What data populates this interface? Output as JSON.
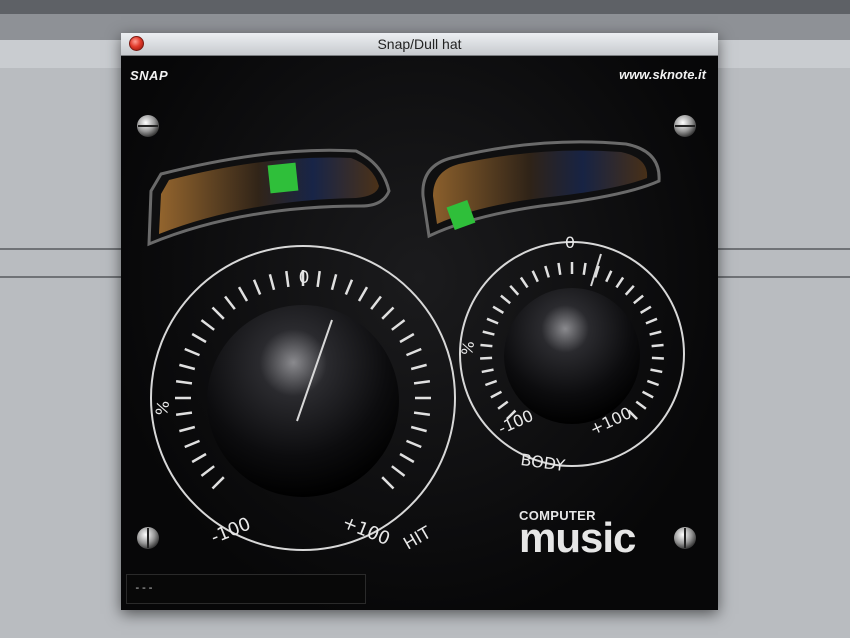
{
  "window": {
    "title": "Snap/Dull hat"
  },
  "plugin": {
    "name": "SNAP",
    "website": "www.sknote.it",
    "display_text": "---"
  },
  "knobs": {
    "hit": {
      "label": "HIT",
      "zero": "0",
      "min": "-100",
      "max": "+100",
      "unit": "%"
    },
    "body": {
      "label": "BODY",
      "zero": "0",
      "min": "-100",
      "max": "+100",
      "unit": "%"
    }
  },
  "logo": {
    "top": "COMPUTER",
    "bottom": "music"
  },
  "colors": {
    "panel": "#0b0b0c",
    "indicator_green": "#2fbf3a",
    "meter_amber": "#c58a3a",
    "close_button": "#e23b2c",
    "text": "#e8e8e8"
  },
  "icons": [
    "close-button-icon",
    "screw-icon"
  ]
}
